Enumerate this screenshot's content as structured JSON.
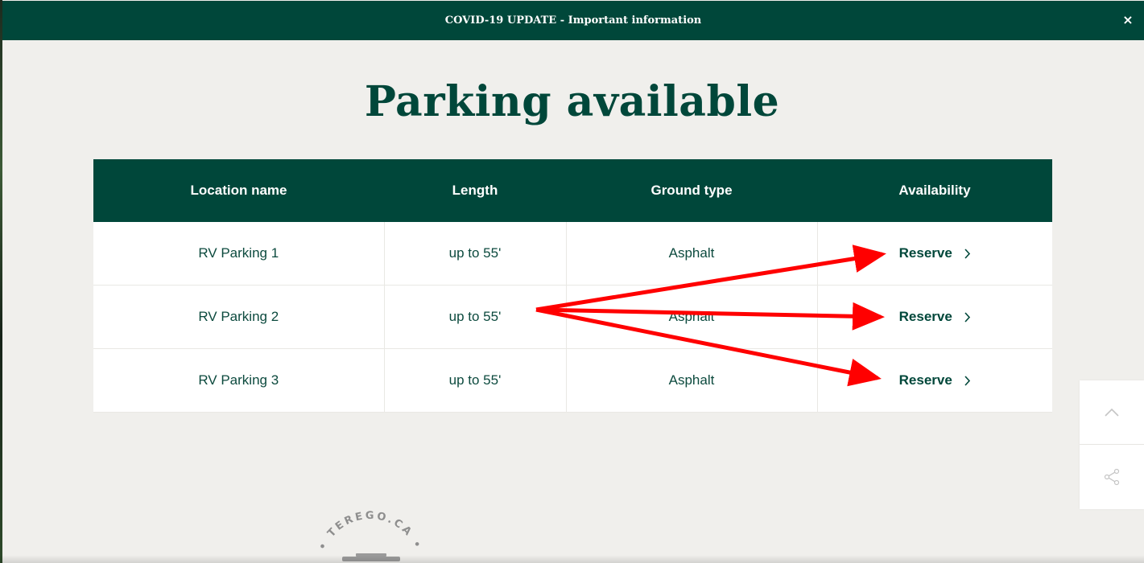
{
  "banner": {
    "text": "COVID-19 UPDATE - Important information",
    "close": "×"
  },
  "page": {
    "title": "Parking available"
  },
  "table": {
    "headers": [
      "Location name",
      "Length",
      "Ground type",
      "Availability"
    ],
    "rows": [
      {
        "location": "RV Parking 1",
        "length": "up to 55'",
        "ground": "Asphalt",
        "action": "Reserve"
      },
      {
        "location": "RV Parking 2",
        "length": "up to 55'",
        "ground": "Asphalt",
        "action": "Reserve"
      },
      {
        "location": "RV Parking 3",
        "length": "up to 55'",
        "ground": "Asphalt",
        "action": "Reserve"
      }
    ]
  },
  "stamp": {
    "text": "TEREGO.CA"
  },
  "side_panel": {
    "icons": [
      "chevron-up-icon",
      "share-icon"
    ]
  },
  "colors": {
    "brand": "#00473a",
    "background": "#f0efec",
    "annotation": "#ff0000"
  }
}
